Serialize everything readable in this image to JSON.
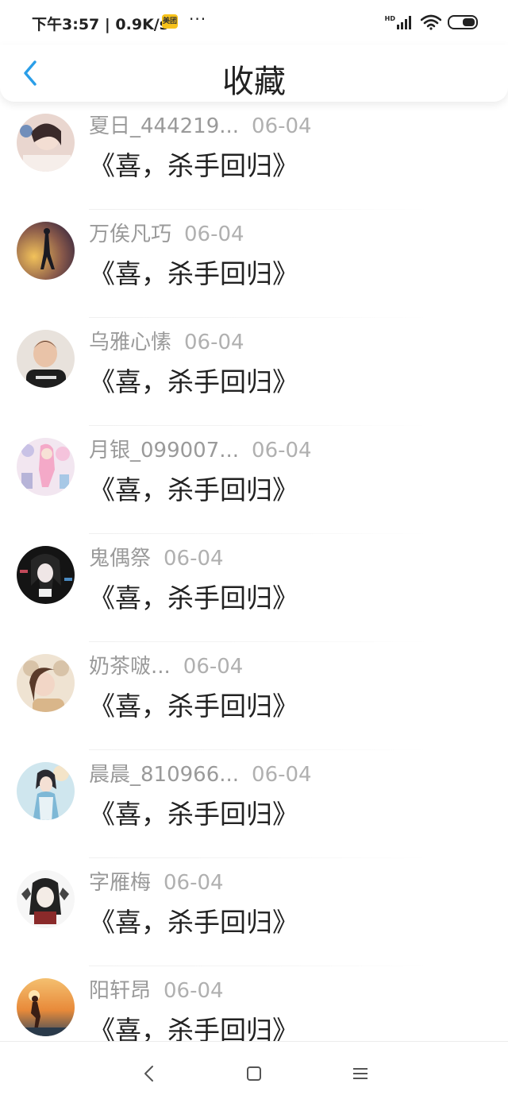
{
  "status": {
    "time": "下午3:57 | 0.9K/s",
    "badge": "美团",
    "dots": "···",
    "hd": "HD"
  },
  "header": {
    "title": "收藏"
  },
  "items": [
    {
      "user": "夏日_444219...",
      "date": "06-04",
      "title": "《喜，杀手回归》",
      "avatar_colors": [
        "#e9d6cf",
        "#3a2a2a"
      ]
    },
    {
      "user": "万俟凡巧",
      "date": "06-04",
      "title": "《喜，杀手回归》",
      "avatar_colors": [
        "#d9a24a",
        "#3b2a40"
      ]
    },
    {
      "user": "乌雅心愫",
      "date": "06-04",
      "title": "《喜，杀手回归》",
      "avatar_colors": [
        "#e8d2c4",
        "#2a2a2a"
      ]
    },
    {
      "user": "月银_099007...",
      "date": "06-04",
      "title": "《喜，杀手回归》",
      "avatar_colors": [
        "#f2d5e6",
        "#b7b4d8"
      ]
    },
    {
      "user": "鬼偶祭",
      "date": "06-04",
      "title": "《喜，杀手回归》",
      "avatar_colors": [
        "#1a1a1a",
        "#c24a5a"
      ]
    },
    {
      "user": "奶茶啵...",
      "date": "06-04",
      "title": "《喜，杀手回归》",
      "avatar_colors": [
        "#efe3d2",
        "#5a3a2a"
      ]
    },
    {
      "user": "晨晨_810966...",
      "date": "06-04",
      "title": "《喜，杀手回归》",
      "avatar_colors": [
        "#a9d3e0",
        "#3a6a80"
      ]
    },
    {
      "user": "字雁梅",
      "date": "06-04",
      "title": "《喜，杀手回归》",
      "avatar_colors": [
        "#f4f4f4",
        "#2a2a2a"
      ]
    },
    {
      "user": "阳轩昂",
      "date": "06-04",
      "title": "《喜，杀手回归》",
      "avatar_colors": [
        "#f0a040",
        "#2a3a4a"
      ]
    }
  ],
  "colors": {
    "accent": "#2a9ee8",
    "text": "#222222",
    "meta": "#9a9a9a"
  },
  "icons": {
    "back": "chevron-left-icon",
    "nav_back": "triangle-back-icon",
    "nav_home": "square-home-icon",
    "nav_menu": "menu-lines-icon"
  }
}
